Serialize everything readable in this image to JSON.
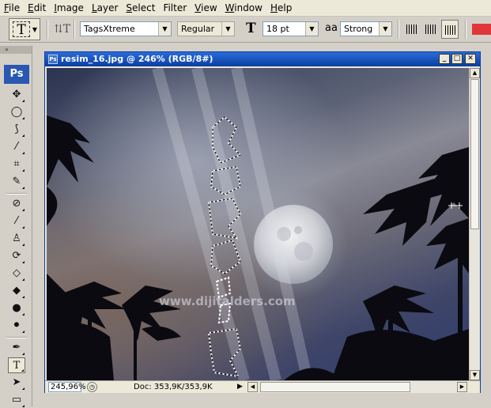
{
  "menu": {
    "items": [
      {
        "mnemonic": "F",
        "rest": "ile"
      },
      {
        "mnemonic": "E",
        "rest": "dit"
      },
      {
        "mnemonic": "I",
        "rest": "mage"
      },
      {
        "mnemonic": "L",
        "rest": "ayer"
      },
      {
        "mnemonic": "S",
        "rest": "elect"
      },
      {
        "mnemonic": "",
        "rest": "Filter"
      },
      {
        "mnemonic": "V",
        "rest": "iew"
      },
      {
        "mnemonic": "W",
        "rest": "indow"
      },
      {
        "mnemonic": "H",
        "rest": "elp"
      }
    ]
  },
  "options": {
    "font_family": "TagsXtreme",
    "font_style": "Regular",
    "font_size": "18 pt",
    "antialias": "Strong",
    "text_color": "#e03838"
  },
  "toolbox": {
    "logo": "Ps"
  },
  "document": {
    "title": "resim_16.jpg @ 246% (RGB/8#)",
    "zoom": "245,96%",
    "doc_info": "Doc: 353,9K/353,9K",
    "watermark": "www.dijitalders.com"
  }
}
